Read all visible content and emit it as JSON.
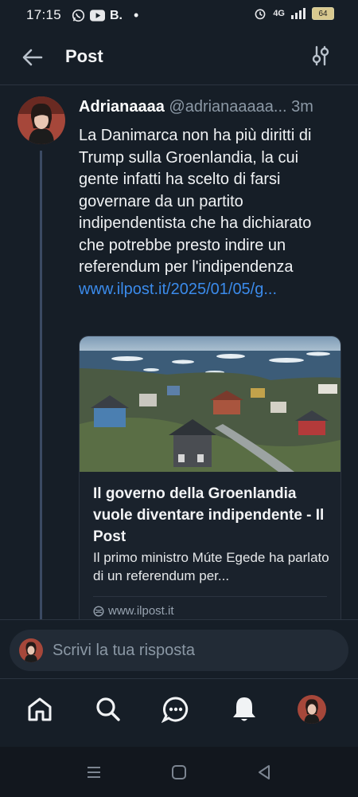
{
  "status_bar": {
    "time": "17:15",
    "carrier_badge": "B.",
    "network": "4G",
    "battery": "64"
  },
  "header": {
    "title": "Post"
  },
  "post": {
    "author_name": "Adrianaaaa",
    "author_handle": "@adrianaaaaa...",
    "time_ago": "3m",
    "text": "La Danimarca non ha più diritti di Trump sulla Groenlandia, la cui gente infatti ha scelto di farsi governare da un partito indipendentista che ha dichiarato che potrebbe presto indire un referendum per l'indipendenza ",
    "link_text": "www.ilpost.it/2025/01/05/g...",
    "card": {
      "title": "Il governo della Groenlandia vuole diventare indipendente - Il Post",
      "description": "Il primo ministro Múte Egede ha parlato di un referendum per...",
      "domain": "www.ilpost.it"
    }
  },
  "reply": {
    "placeholder": "Scrivi la tua risposta"
  },
  "tabs": [
    {
      "icon": "home-icon"
    },
    {
      "icon": "search-icon"
    },
    {
      "icon": "chat-icon"
    },
    {
      "icon": "notifications-icon"
    },
    {
      "icon": "profile-avatar"
    }
  ],
  "colors": {
    "background": "#161e27",
    "link": "#3b8beb",
    "muted": "#8b98a5",
    "thread_line": "#3b4a63"
  }
}
